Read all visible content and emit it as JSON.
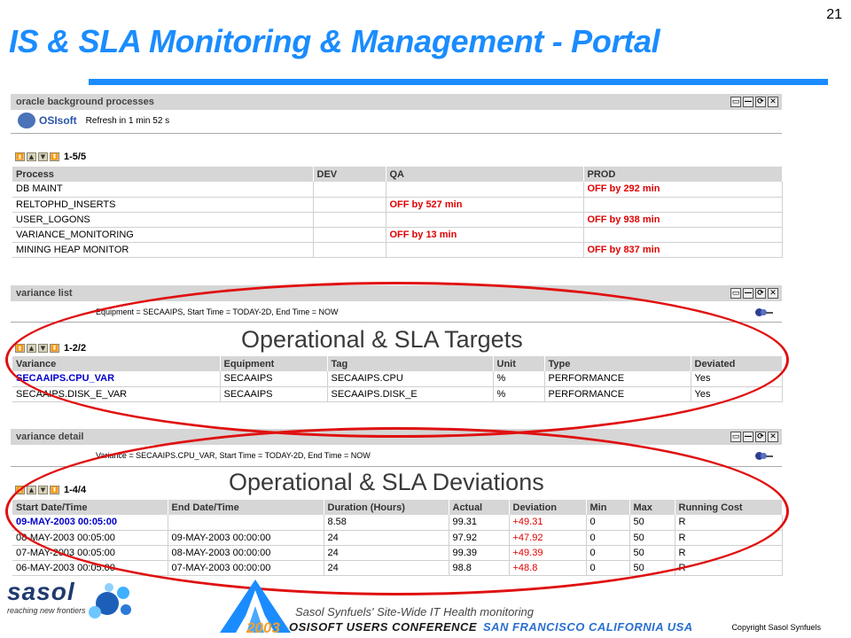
{
  "slide": {
    "title": "IS & SLA  Monitoring & Management - Portal",
    "page_number": "21",
    "footer_caption": "Sasol Synfuels' Site-Wide IT Health monitoring",
    "conference_year": "2003",
    "conference_name": "OSISOFT USERS CONFERENCE",
    "conference_location": "SAN FRANCISCO CALIFORNIA USA",
    "copyright": "Copyright Sasol Synfuels",
    "sasol_name": "sasol",
    "sasol_tagline": "reaching new frontiers",
    "accent_color": "#1a8cff",
    "highlight_color": "#e01010"
  },
  "portlet_controls": [
    "▭",
    "—",
    "⟳",
    "✕"
  ],
  "pager_buttons": [
    "⏫",
    "▲",
    "▼",
    "⏬"
  ],
  "portlet1": {
    "title": "oracle background processes",
    "logo_text": "OSIsoft",
    "refresh_text": "Refresh in 1 min 52 s",
    "pager_count": "1-5/5",
    "columns": [
      "Process",
      "DEV",
      "QA",
      "PROD"
    ],
    "rows": [
      [
        "DB MAINT",
        "",
        "",
        "OFF by 292 min"
      ],
      [
        "RELTOPHD_INSERTS",
        "",
        "OFF by 527 min",
        ""
      ],
      [
        "USER_LOGONS",
        "",
        "",
        "OFF by 938 min"
      ],
      [
        "VARIANCE_MONITORING",
        "",
        "OFF by 13 min",
        ""
      ],
      [
        "MINING HEAP MONITOR",
        "",
        "",
        "OFF by 837 min"
      ]
    ]
  },
  "portlet2": {
    "title": "variance list",
    "query": "Equipment = SECAAIPS, Start Time = TODAY-2D, End Time = NOW",
    "pager_count": "1-2/2",
    "overlay_label": "Operational  & SLA Targets",
    "columns": [
      "Variance",
      "Equipment",
      "Tag",
      "Unit",
      "Type",
      "Deviated"
    ],
    "rows": [
      [
        "SECAAIPS.CPU_VAR",
        "SECAAIPS",
        "SECAAIPS.CPU",
        "%",
        "PERFORMANCE",
        "Yes"
      ],
      [
        "SECAAIPS.DISK_E_VAR",
        "SECAAIPS",
        "SECAAIPS.DISK_E",
        "%",
        "PERFORMANCE",
        "Yes"
      ]
    ]
  },
  "portlet3": {
    "title": "variance detail",
    "query": "Variance = SECAAIPS.CPU_VAR, Start Time = TODAY-2D, End Time = NOW",
    "pager_count": "1-4/4",
    "overlay_label": "Operational  & SLA Deviations",
    "columns": [
      "Start Date/Time",
      "End Date/Time",
      "Duration (Hours)",
      "Actual",
      "Deviation",
      "Min",
      "Max",
      "Running Cost"
    ],
    "rows": [
      [
        "09-MAY-2003 00:05:00",
        "",
        "8.58",
        "99.31",
        "+49.31",
        "0",
        "50",
        "R"
      ],
      [
        "08-MAY-2003 00:05:00",
        "09-MAY-2003 00:00:00",
        "24",
        "97.92",
        "+47.92",
        "0",
        "50",
        "R"
      ],
      [
        "07-MAY-2003 00:05:00",
        "08-MAY-2003 00:00:00",
        "24",
        "99.39",
        "+49.39",
        "0",
        "50",
        "R"
      ],
      [
        "06-MAY-2003 00:05:00",
        "07-MAY-2003 00:00:00",
        "24",
        "98.8",
        "+48.8",
        "0",
        "50",
        "R"
      ]
    ]
  }
}
